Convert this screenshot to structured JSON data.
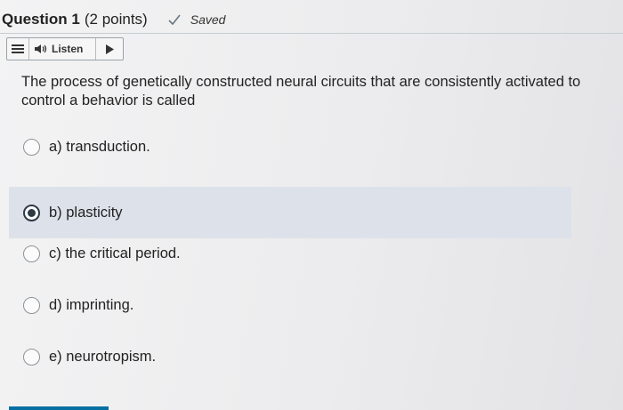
{
  "header": {
    "question_label": "Question 1",
    "points": "(2 points)",
    "saved_label": "Saved"
  },
  "listen_bar": {
    "listen_label": "Listen"
  },
  "question": {
    "text": "The process of genetically constructed neural circuits that are consistently activated to control a behavior is called"
  },
  "options": [
    {
      "label": "a) transduction.",
      "selected": false
    },
    {
      "label": "b) plasticity",
      "selected": true
    },
    {
      "label": "c) the critical period.",
      "selected": false
    },
    {
      "label": "d) imprinting.",
      "selected": false
    },
    {
      "label": "e) neurotropism.",
      "selected": false
    }
  ],
  "colors": {
    "selected_row_bg": "#dde2ea",
    "text": "#222222",
    "accent": "#0770a3"
  }
}
